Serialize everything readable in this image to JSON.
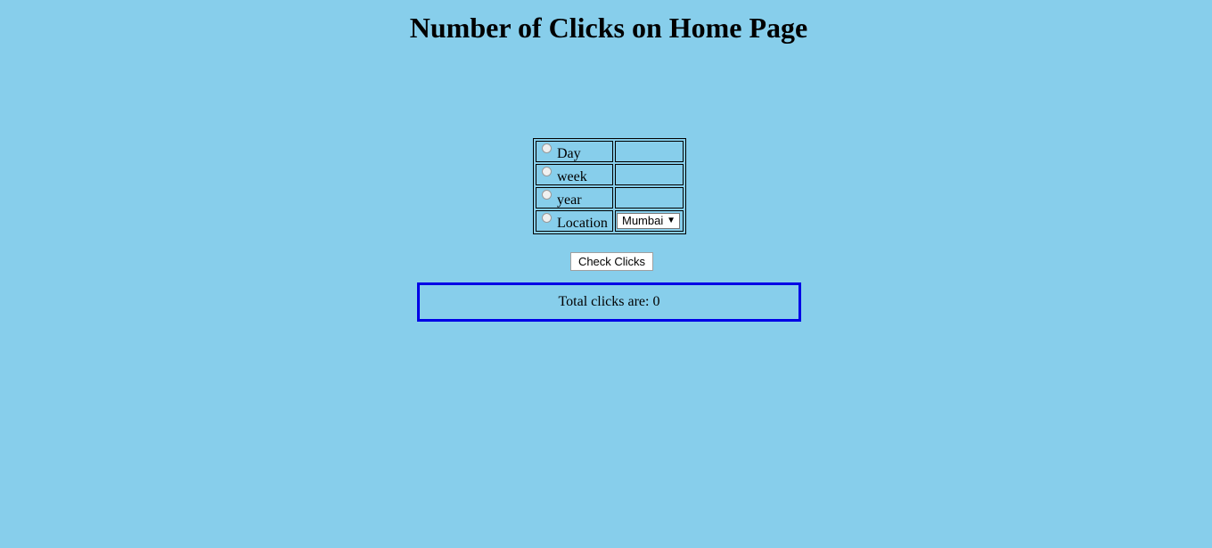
{
  "page": {
    "title": "Number of Clicks on Home Page",
    "background_color": "#87ceeb"
  },
  "options": [
    {
      "label": "Day",
      "selected": false,
      "value": ""
    },
    {
      "label": "week",
      "selected": false,
      "value": ""
    },
    {
      "label": "year",
      "selected": false,
      "value": ""
    },
    {
      "label": "Location",
      "selected": false
    }
  ],
  "location_select": {
    "selected": "Mumbai",
    "arrow_icon": "triangle-down-icon"
  },
  "check_button": {
    "label": "Check Clicks"
  },
  "result": {
    "label": "Total clicks are:",
    "count": "0",
    "border_color": "#0000e6"
  }
}
